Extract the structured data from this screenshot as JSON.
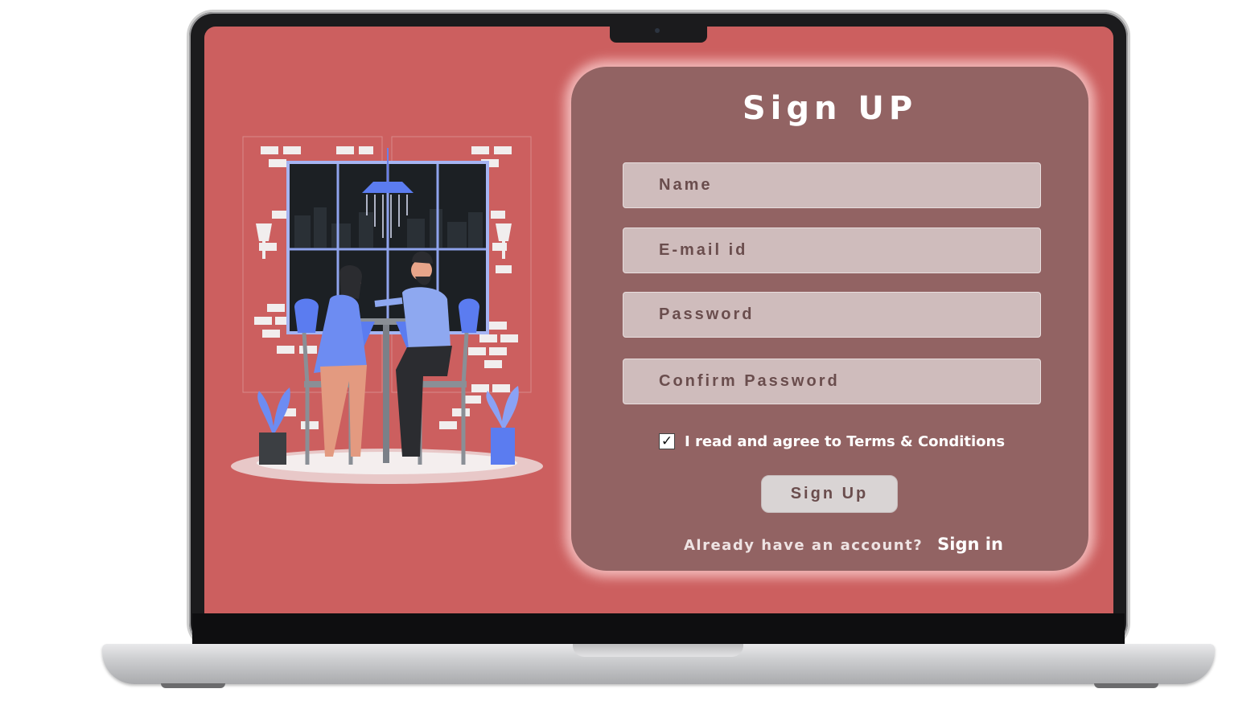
{
  "card": {
    "title": "Sign UP",
    "fields": {
      "name_placeholder": "Name",
      "email_placeholder": "E-mail id",
      "password_placeholder": "Password",
      "confirm_password_placeholder": "Confirm Password"
    },
    "terms": {
      "checked": true,
      "check_glyph": "✓",
      "label": "I read and agree to Terms & Conditions"
    },
    "signup_button_label": "Sign Up",
    "already_text": "Already have an account?",
    "signin_link_label": "Sign in"
  },
  "colors": {
    "screen_background": "#cc5f5f",
    "card_background": "#926363",
    "input_background": "#cfbcbc",
    "input_text": "#6a4d4d",
    "button_background": "#d9d4d4",
    "illustration_accent": "#5b7cf0"
  },
  "icons": {
    "checkbox": "check-icon",
    "illustration": "couple-dinner-illustration"
  }
}
